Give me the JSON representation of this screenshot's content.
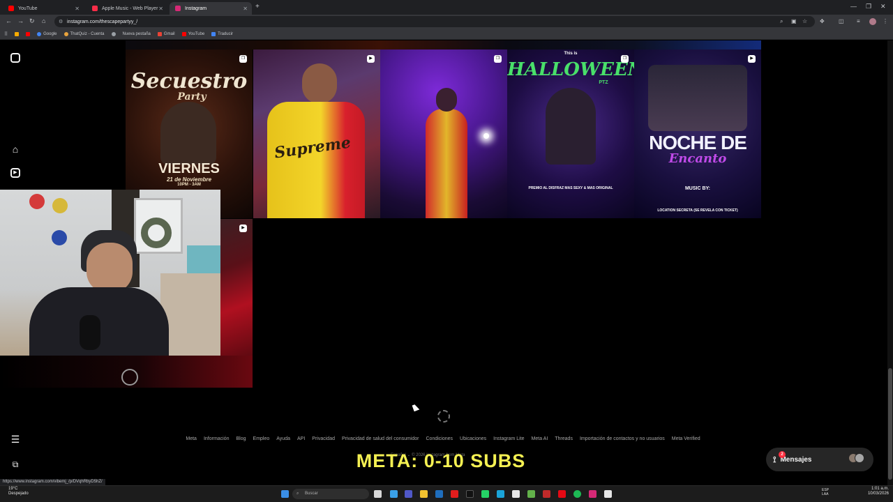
{
  "browser": {
    "tabs": [
      {
        "title": "YouTube",
        "favicon_color": "#ff0000"
      },
      {
        "title": "Apple Music - Web Player",
        "favicon_color": "#fa2d48"
      },
      {
        "title": "Instagram",
        "favicon_color": "#d62976",
        "active": true
      }
    ],
    "url": "instagram.com/thescapepartyy_/",
    "bookmarks": [
      {
        "label": "Google",
        "color": "#4285f4"
      },
      {
        "label": "ThatQuiz - Cuenta",
        "color": "#e8a33d"
      },
      {
        "label": "",
        "color": "#5f6368"
      },
      {
        "label": "Nueva pestaña",
        "color": "#5f6368"
      },
      {
        "label": "Gmail",
        "color": "#ea4335"
      },
      {
        "label": "YouTube",
        "color": "#ff0000"
      },
      {
        "label": "Traducir",
        "color": "#4285f4"
      }
    ],
    "status_url": "https://www.instagram.com/vibemj_/p/DVqhRbyD5hZ/"
  },
  "grid_tiles": [
    {
      "title": "Secuestro",
      "subtitle": "Party",
      "day": "VIERNES",
      "date": "21 de Noviembre",
      "time": "10PM - 3AM",
      "badge": "carousel"
    },
    {
      "shirt_text": "Supreme",
      "badge": "reel"
    },
    {
      "badge": "carousel"
    },
    {
      "title": "HALLOWEEN",
      "prefix": "This is",
      "suffix": "PTZ",
      "premio": "PREMIO AL DISFRAZ MAS SEXY & MAS ORIGINAL",
      "badge": "carousel"
    },
    {
      "title": "NOCHE DE",
      "subtitle": "Encanto",
      "music": "MUSIC BY:",
      "location": "LOCATION SECRETA (SE REVELA CON TICKET)",
      "badge": "reel"
    }
  ],
  "footer": {
    "links": [
      "Meta",
      "Información",
      "Blog",
      "Empleo",
      "Ayuda",
      "API",
      "Privacidad",
      "Privacidad de salud del consumidor",
      "Condiciones",
      "Ubicaciones",
      "Instagram Lite",
      "Meta AI",
      "Threads",
      "Importación de contactos y no usuarios",
      "Meta Verified"
    ],
    "language": "Español",
    "copyright": "© 2026 Instagram from Meta"
  },
  "overlay": {
    "text": "META: 0-10 SUBS"
  },
  "messages": {
    "label": "Mensajes",
    "count": "2"
  },
  "taskbar": {
    "search_placeholder": "Buscar",
    "weather_temp": "19°C",
    "weather_desc": "Despejado",
    "lang_line1": "ESP",
    "lang_line2": "LAA",
    "time": "1:01 a.m.",
    "date": "10/03/2026"
  }
}
